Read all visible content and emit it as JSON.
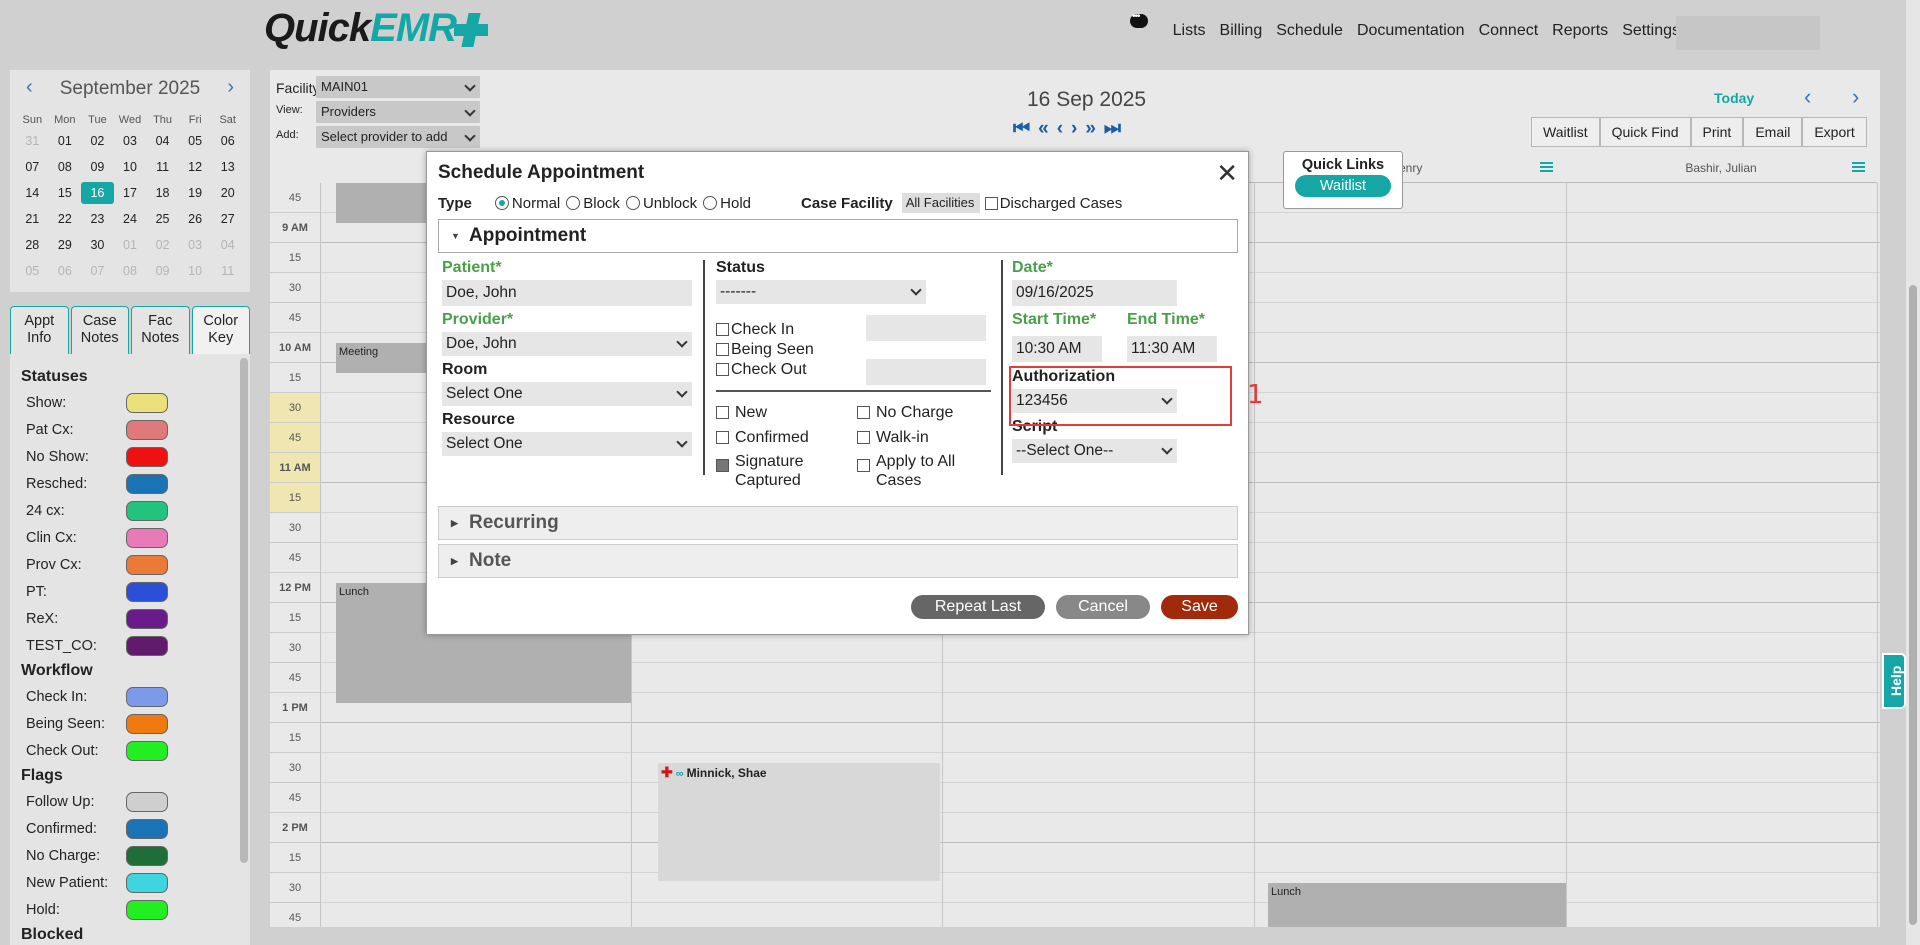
{
  "app": {
    "logo_part1": "Quick",
    "logo_part2": "EMR"
  },
  "nav": [
    "Lists",
    "Billing",
    "Schedule",
    "Documentation",
    "Connect",
    "Reports",
    "Settings"
  ],
  "mini_calendar": {
    "month": "September 2025",
    "dow": [
      "Sun",
      "Mon",
      "Tue",
      "Wed",
      "Thu",
      "Fri",
      "Sat"
    ],
    "weeks": [
      [
        "31",
        "01",
        "02",
        "03",
        "04",
        "05",
        "06"
      ],
      [
        "07",
        "08",
        "09",
        "10",
        "11",
        "12",
        "13"
      ],
      [
        "14",
        "15",
        "16",
        "17",
        "18",
        "19",
        "20"
      ],
      [
        "21",
        "22",
        "23",
        "24",
        "25",
        "26",
        "27"
      ],
      [
        "28",
        "29",
        "30",
        "01",
        "02",
        "03",
        "04"
      ],
      [
        "05",
        "06",
        "07",
        "08",
        "09",
        "10",
        "11"
      ]
    ],
    "selected": "16"
  },
  "side_tabs": [
    {
      "l1": "Appt",
      "l2": "Info"
    },
    {
      "l1": "Case",
      "l2": "Notes"
    },
    {
      "l1": "Fac",
      "l2": "Notes"
    },
    {
      "l1": "Color",
      "l2": "Key"
    }
  ],
  "color_key": {
    "statuses_title": "Statuses",
    "statuses": [
      {
        "label": "Show:",
        "color": "#ebe07a"
      },
      {
        "label": "Pat Cx:",
        "color": "#e07a7a"
      },
      {
        "label": "No Show:",
        "color": "#ee1111"
      },
      {
        "label": "Resched:",
        "color": "#1a73b5"
      },
      {
        "label": "24 cx:",
        "color": "#22c47d"
      },
      {
        "label": "Clin Cx:",
        "color": "#e87ab8"
      },
      {
        "label": "Prov Cx:",
        "color": "#ea7a35"
      },
      {
        "label": "PT:",
        "color": "#2c4fd8"
      },
      {
        "label": "ReX:",
        "color": "#6a1b8a"
      },
      {
        "label": "TEST_CO:",
        "color": "#621a6e"
      }
    ],
    "workflow_title": "Workflow",
    "workflow": [
      {
        "label": "Check In:",
        "color": "#7b9bea"
      },
      {
        "label": "Being Seen:",
        "color": "#ee7a10"
      },
      {
        "label": "Check Out:",
        "color": "#22ee22"
      }
    ],
    "flags_title": "Flags",
    "flags": [
      {
        "label": "Follow Up:",
        "color": "#cfcfcf"
      },
      {
        "label": "Confirmed:",
        "color": "#1a73b5"
      },
      {
        "label": "No Charge:",
        "color": "#1f6e3a"
      },
      {
        "label": "New Patient:",
        "color": "#3ed4e0"
      },
      {
        "label": "Hold:",
        "color": "#22ee22"
      }
    ],
    "blocked_title": "Blocked"
  },
  "controls": {
    "facility_label": "Facility:",
    "facility_value": "MAIN01",
    "view_label": "View:",
    "view_value": "Providers",
    "add_label": "Add:",
    "add_value": "Select provider to add"
  },
  "schedule": {
    "date": "16 Sep 2025",
    "today": "Today",
    "buttons": [
      "Waitlist",
      "Quick Find",
      "Print",
      "Email",
      "Export"
    ],
    "columns": [
      "",
      "",
      "",
      "enry",
      "Bashir, Julian"
    ],
    "times": [
      {
        "t": "45"
      },
      {
        "t": "9 AM",
        "hr": true
      },
      {
        "t": "15"
      },
      {
        "t": "30"
      },
      {
        "t": "45"
      },
      {
        "t": "10 AM",
        "hr": true
      },
      {
        "t": "15"
      },
      {
        "t": "30",
        "hl": true
      },
      {
        "t": "45",
        "hl": true
      },
      {
        "t": "11 AM",
        "hr": true,
        "hl": true
      },
      {
        "t": "15",
        "hl": true
      },
      {
        "t": "30"
      },
      {
        "t": "45"
      },
      {
        "t": "12 PM",
        "hr": true
      },
      {
        "t": "15"
      },
      {
        "t": "30"
      },
      {
        "t": "45"
      },
      {
        "t": "1 PM",
        "hr": true
      },
      {
        "t": "15"
      },
      {
        "t": "30"
      },
      {
        "t": "45"
      },
      {
        "t": "2 PM",
        "hr": true
      },
      {
        "t": "15"
      },
      {
        "t": "30"
      },
      {
        "t": "45"
      }
    ],
    "blocks": {
      "meeting": "Meeting",
      "lunch1": "Lunch",
      "lunch2": "Lunch"
    },
    "appointment_name": "Minnick, Shae"
  },
  "quick_links": {
    "title": "Quick Links",
    "button": "Waitlist"
  },
  "dialog": {
    "title": "Schedule Appointment",
    "type_label": "Type",
    "types": [
      {
        "label": "Normal",
        "on": true
      },
      {
        "label": "Block",
        "on": false
      },
      {
        "label": "Unblock",
        "on": false
      },
      {
        "label": "Hold",
        "on": false
      }
    ],
    "case_facility_label": "Case Facility",
    "case_facility_value": "All Facilities",
    "discharged_label": "Discharged Cases",
    "appointment_section": "Appointment",
    "patient_label": "Patient*",
    "patient_value": "Doe, John",
    "provider_label": "Provider*",
    "provider_value": "Doe, John",
    "room_label": "Room",
    "room_value": "Select One",
    "resource_label": "Resource",
    "resource_value": "Select One",
    "status_label": "Status",
    "status_value": "-------",
    "check_in": "Check In",
    "being_seen": "Being Seen",
    "check_out": "Check Out",
    "new": "New",
    "no_charge": "No Charge",
    "confirmed": "Confirmed",
    "walk_in": "Walk-in",
    "signature_l1": "Signature",
    "signature_l2": "Captured",
    "apply_l1": "Apply to All",
    "apply_l2": "Cases",
    "date_label": "Date*",
    "date_value": "09/16/2025",
    "start_label": "Start Time*",
    "start_value": "10:30 AM",
    "end_label": "End Time*",
    "end_value": "11:30 AM",
    "authorization_label": "Authorization",
    "authorization_value": "123456",
    "script_label": "Script",
    "script_value": "--Select One--",
    "recurring_section": "Recurring",
    "note_section": "Note",
    "repeat_last": "Repeat Last",
    "cancel": "Cancel",
    "save": "Save"
  },
  "annotation": {
    "number": "1"
  },
  "help": "Help"
}
